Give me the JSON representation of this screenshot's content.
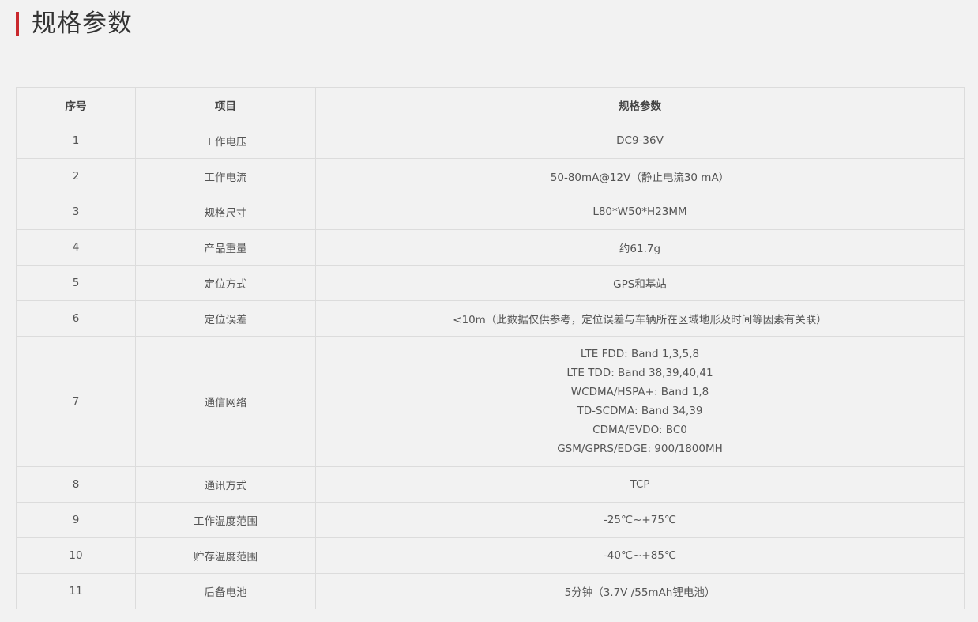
{
  "heading": {
    "title": "规格参数",
    "accent_color": "#c9282d"
  },
  "table": {
    "headers": {
      "no": "序号",
      "item": "项目",
      "spec": "规格参数"
    },
    "rows": [
      {
        "no": "1",
        "item": "工作电压",
        "spec": [
          "DC9-36V"
        ]
      },
      {
        "no": "2",
        "item": "工作电流",
        "spec": [
          "50-80mA@12V（静止电流30 mA）"
        ]
      },
      {
        "no": "3",
        "item": "规格尺寸",
        "spec": [
          "L80*W50*H23MM"
        ]
      },
      {
        "no": "4",
        "item": "产品重量",
        "spec": [
          "约61.7g"
        ]
      },
      {
        "no": "5",
        "item": "定位方式",
        "spec": [
          "GPS和基站"
        ]
      },
      {
        "no": "6",
        "item": "定位误差",
        "spec": [
          "<10m（此数据仅供参考，定位误差与车辆所在区域地形及时间等因素有关联）"
        ]
      },
      {
        "no": "7",
        "item": "通信网络",
        "spec": [
          "LTE FDD: Band 1,3,5,8",
          "LTE TDD: Band 38,39,40,41",
          "WCDMA/HSPA+: Band 1,8",
          "TD-SCDMA: Band 34,39",
          "CDMA/EVDO: BC0",
          "GSM/GPRS/EDGE: 900/1800MH"
        ]
      },
      {
        "no": "8",
        "item": "通讯方式",
        "spec": [
          "TCP"
        ]
      },
      {
        "no": "9",
        "item": "工作温度范围",
        "spec": [
          "-25℃~+75℃"
        ]
      },
      {
        "no": "10",
        "item": "贮存温度范围",
        "spec": [
          "-40℃~+85℃"
        ]
      },
      {
        "no": "11",
        "item": "后备电池",
        "spec": [
          "5分钟（3.7V /55mAh锂电池）"
        ]
      }
    ]
  }
}
